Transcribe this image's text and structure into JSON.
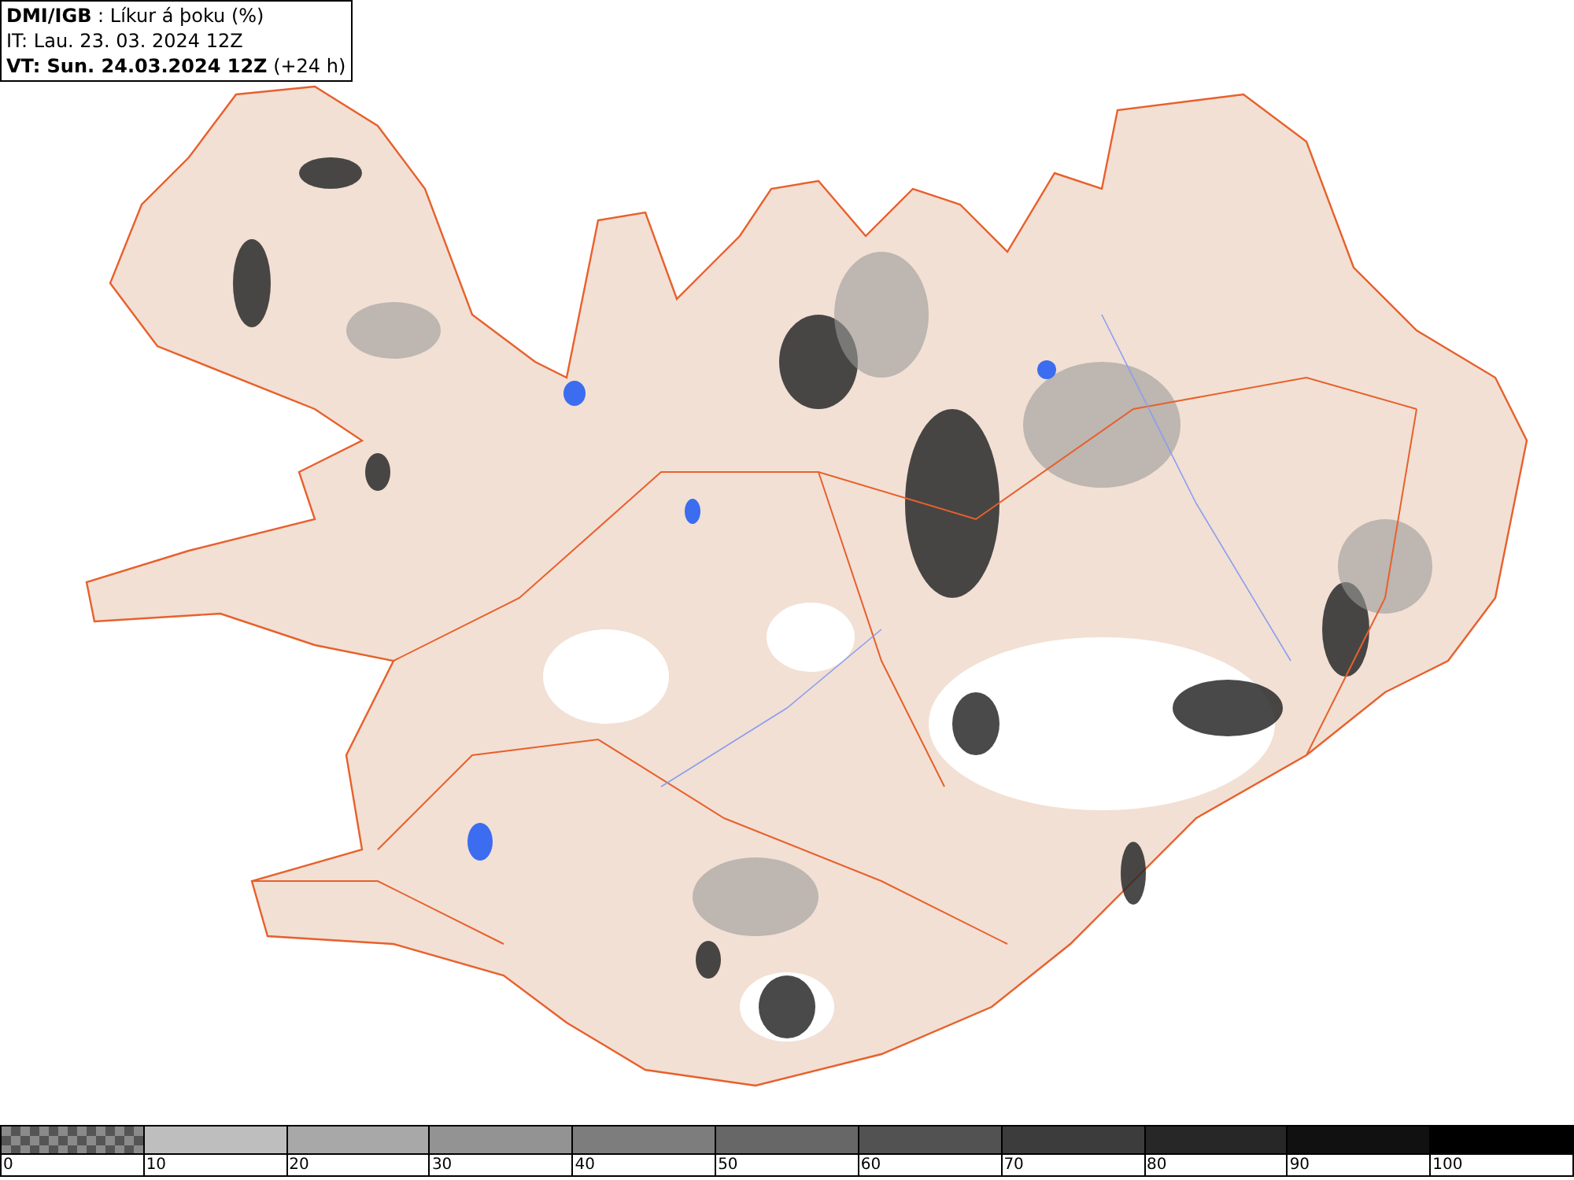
{
  "header": {
    "lines": [
      "**DMI/IGB** : Líkur á þoku (%)",
      "IT: Lau. 23. 03. 2024 12Z",
      "**VT: Sun. 24.03.2024 12Z** (+24 h)"
    ]
  },
  "legend": [
    {
      "kind": "checkered",
      "label": "0"
    },
    {
      "kind": "solid",
      "color": "#bebebe",
      "label": "10"
    },
    {
      "kind": "solid",
      "color": "#a8a8a8",
      "label": "20"
    },
    {
      "kind": "solid",
      "color": "#939393",
      "label": "30"
    },
    {
      "kind": "solid",
      "color": "#7d7d7d",
      "label": "40"
    },
    {
      "kind": "solid",
      "color": "#676767",
      "label": "50"
    },
    {
      "kind": "solid",
      "color": "#525252",
      "label": "60"
    },
    {
      "kind": "solid",
      "color": "#3c3c3c",
      "label": "70"
    },
    {
      "kind": "solid",
      "color": "#272727",
      "label": "80"
    },
    {
      "kind": "solid",
      "color": "#111111",
      "label": "90"
    },
    {
      "kind": "solid",
      "color": "#000000",
      "label": "100"
    }
  ]
}
